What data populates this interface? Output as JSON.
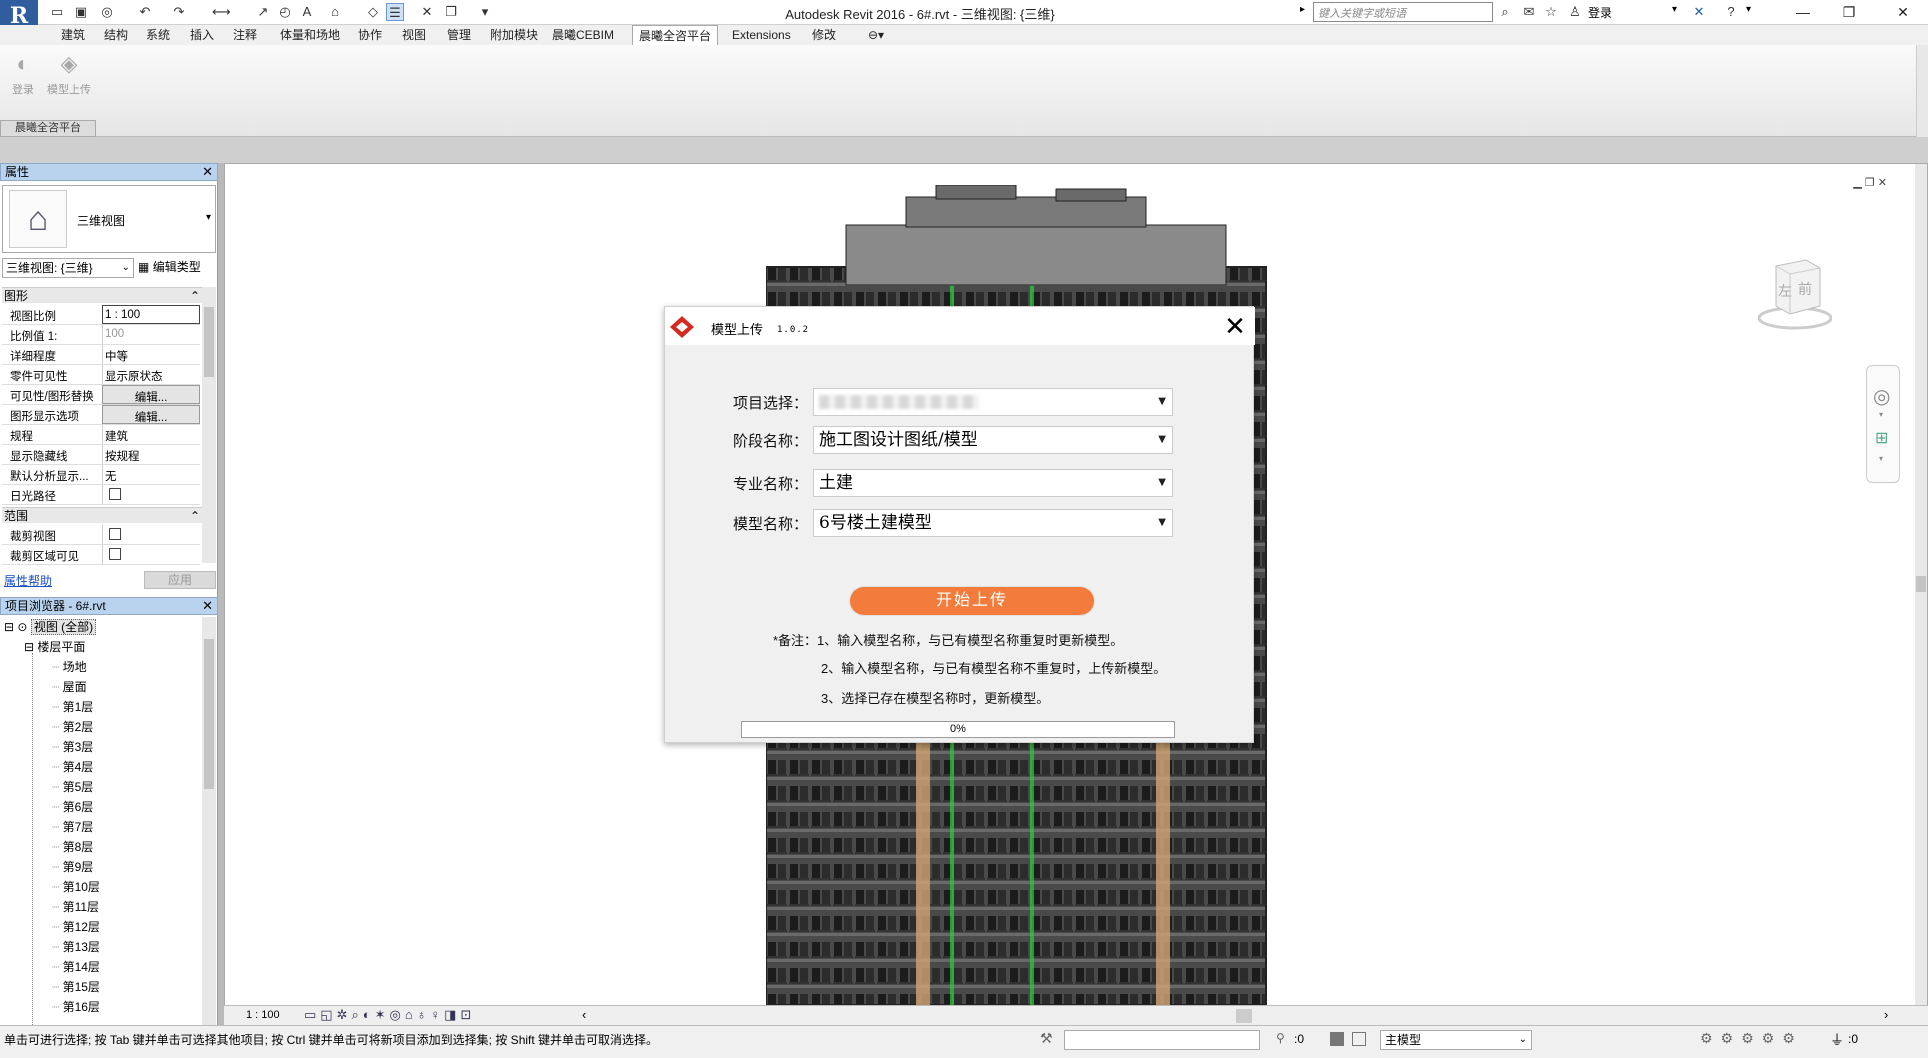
{
  "app": {
    "logo": "R",
    "title": "Autodesk Revit 2016 -    6#.rvt - 三维视图: {三维}",
    "search_placeholder": "键入关键字或短语",
    "signin": "登录"
  },
  "tabs": [
    "建筑",
    "结构",
    "系统",
    "插入",
    "注释",
    "体量和场地",
    "协作",
    "视图",
    "管理",
    "附加模块",
    "晨曦CEBIM",
    "晨曦全咨平台",
    "Extensions",
    "修改"
  ],
  "active_tab": "晨曦全咨平台",
  "ribbon": {
    "buttons": [
      "登录",
      "模型上传"
    ],
    "panel_label": "晨曦全咨平台"
  },
  "properties": {
    "header": "属性",
    "type_name": "三维视图",
    "view_dropdown": "三维视图: {三维}",
    "edit_type": "编辑类型",
    "group_graphics": "图形",
    "rows": [
      {
        "k": "视图比例",
        "v": "1 : 100"
      },
      {
        "k": "比例值 1:",
        "v": "100"
      },
      {
        "k": "详细程度",
        "v": "中等"
      },
      {
        "k": "零件可见性",
        "v": "显示原状态"
      },
      {
        "k": "可见性/图形替换",
        "v": "编辑..."
      },
      {
        "k": "图形显示选项",
        "v": "编辑..."
      },
      {
        "k": "规程",
        "v": "建筑"
      },
      {
        "k": "显示隐藏线",
        "v": "按规程"
      },
      {
        "k": "默认分析显示...",
        "v": "无"
      },
      {
        "k": "日光路径",
        "v": ""
      }
    ],
    "group_extents": "范围",
    "extent_rows": [
      {
        "k": "裁剪视图",
        "v": ""
      },
      {
        "k": "裁剪区域可见",
        "v": ""
      }
    ],
    "help_link": "属性帮助",
    "apply": "应用"
  },
  "browser": {
    "header": "项目浏览器 - 6#.rvt",
    "root": "视图 (全部)",
    "group": "楼层平面",
    "items": [
      "场地",
      "屋面",
      "第1层",
      "第2层",
      "第3层",
      "第4层",
      "第5层",
      "第6层",
      "第7层",
      "第8层",
      "第9层",
      "第10层",
      "第11层",
      "第12层",
      "第13层",
      "第14层",
      "第15层",
      "第16层"
    ]
  },
  "dialog": {
    "title": "模型上传",
    "version": "1.0.2",
    "fields": [
      {
        "label": "项目选择：",
        "value": ""
      },
      {
        "label": "阶段名称：",
        "value": "施工图设计图纸/模型"
      },
      {
        "label": "专业名称：",
        "value": "土建"
      },
      {
        "label": "模型名称：",
        "value": "6号楼土建模型"
      }
    ],
    "upload_button": "开始上传",
    "notes": [
      "*备注：1、输入模型名称，与已有模型名称重复时更新模型。",
      "2、输入模型名称，与已有模型名称不重复时，上传新模型。",
      "3、选择已存在模型名称时，更新模型。"
    ],
    "progress": 0,
    "progress_text": "0%",
    "accent": "#f37b3c"
  },
  "viewcube": {
    "left": "左",
    "front": "前"
  },
  "viewbar": {
    "scale": "1 : 100"
  },
  "status": {
    "text": "单击可进行选择; 按 Tab 键并单击可选择其他项目; 按 Ctrl 键并单击可将新项目添加到选择集; 按 Shift 键并单击可取消选择。",
    "count1": ":0",
    "model": "主模型",
    "count2": ":0"
  }
}
